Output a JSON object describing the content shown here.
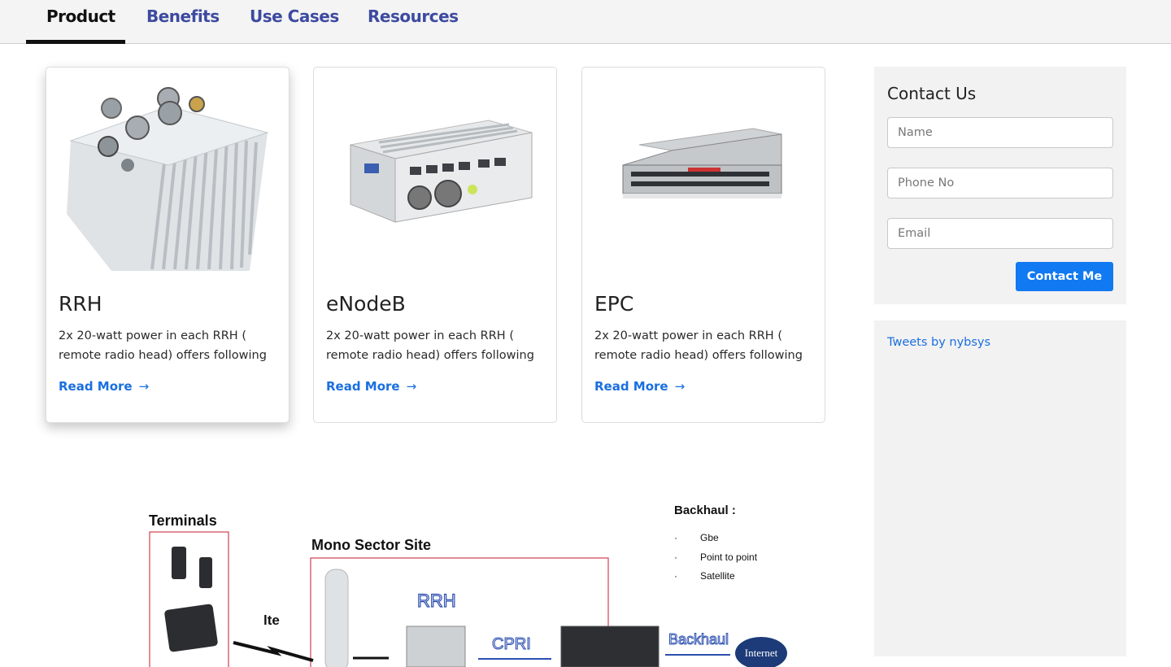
{
  "tabs": [
    {
      "label": "Product",
      "active": true
    },
    {
      "label": "Benefits",
      "active": false
    },
    {
      "label": "Use Cases",
      "active": false
    },
    {
      "label": "Resources",
      "active": false
    }
  ],
  "products": [
    {
      "title": "RRH",
      "description": "2x 20-watt power in each RRH ( remote radio head) offers following",
      "link": "Read More",
      "arrow": "→",
      "image_icon": "rrh-unit-image"
    },
    {
      "title": "eNodeB",
      "description": "2x 20-watt power in each RRH ( remote radio head) offers following",
      "link": "Read More",
      "arrow": "→",
      "image_icon": "enodeb-server-image"
    },
    {
      "title": "EPC",
      "description": "2x 20-watt power in each RRH ( remote radio head) offers following",
      "link": "Read More",
      "arrow": "→",
      "image_icon": "epc-rack-server-image"
    }
  ],
  "contact": {
    "title": "Contact Us",
    "name_placeholder": "Name",
    "phone_placeholder": "Phone No",
    "email_placeholder": "Email",
    "button": "Contact Me"
  },
  "tweets": {
    "link": "Tweets by nybsys"
  },
  "diagram": {
    "terminals": "Terminals",
    "site": "Mono Sector Site",
    "backhaul_title": "Backhaul :",
    "backhaul_items": [
      "Gbe",
      "Point to point",
      "Satellite"
    ],
    "bullet": "·",
    "lte": "lte",
    "rrh": "RRH",
    "cpri": "CPRI",
    "backhaul": "Backhaul",
    "internet": "Internet"
  },
  "colors": {
    "accent": "#1a6fe0",
    "button": "#1179f2",
    "tab": "#3d4aa0",
    "panel": "#f2f2f2"
  }
}
